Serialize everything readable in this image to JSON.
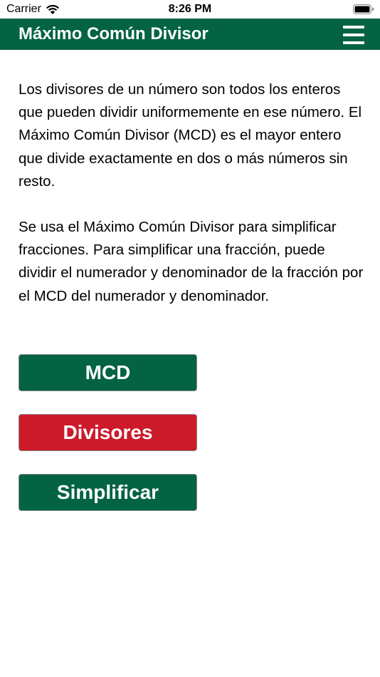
{
  "status_bar": {
    "carrier": "Carrier",
    "time": "8:26 PM",
    "icons": [
      "wifi-icon",
      "battery-icon"
    ]
  },
  "nav": {
    "title": "Máximo Común Divisor",
    "menu_icon": "hamburger-menu-icon"
  },
  "content": {
    "paragraph_1": "Los divisores de un número son todos los enteros que pueden dividir uniformemente en ese número. El Máximo Común Divisor (MCD) es el mayor entero que divide exactamente en dos o más números sin resto.",
    "paragraph_2": "Se usa el Máximo Común Divisor para simplificar fracciones. Para simplificar una fracción, puede dividir el numerador y denominador de la fracción por el MCD del numerador y denominador."
  },
  "buttons": {
    "mcd_label": "MCD",
    "divisores_label": "Divisores",
    "simplificar_label": "Simplificar"
  },
  "colors": {
    "brand_green": "#036343",
    "accent_red": "#cc1a2b",
    "text": "#000000",
    "background": "#ffffff"
  }
}
